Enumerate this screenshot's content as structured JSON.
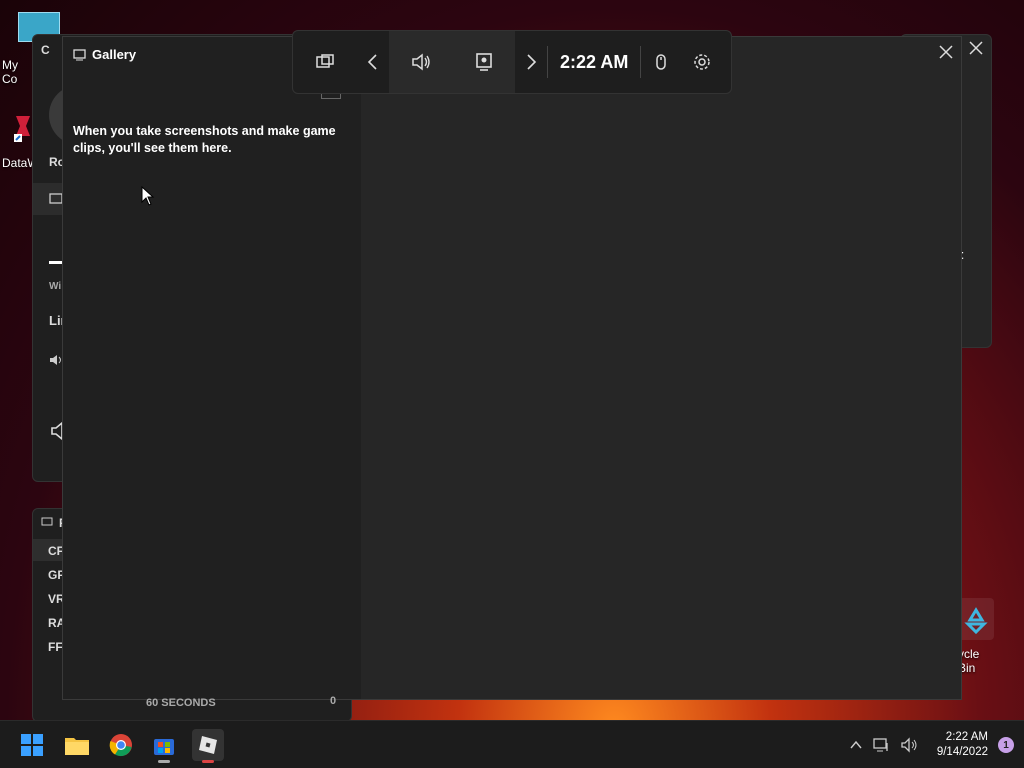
{
  "desktop": {
    "icons": [
      {
        "label": "My Co"
      },
      {
        "label": "DataW"
      },
      {
        "label": "ycle Bin"
      }
    ]
  },
  "background_widgets": {
    "capture_title_fragment": "C",
    "capture_row_labels": [
      "Ro",
      "Wi",
      "Lin"
    ],
    "performance_title_fragment": "P",
    "performance_rows": [
      "CF",
      "GF",
      "VR",
      "RA",
      "FF"
    ],
    "seconds_label": "60 SECONDS",
    "seconds_value": "0",
    "audio_fragment": "t"
  },
  "gallery": {
    "title": "Gallery",
    "empty_message": "When you take screenshots and make game clips, you'll see them here."
  },
  "gamebar": {
    "time": "2:22 AM",
    "buttons": [
      "widget-menu",
      "previous",
      "audio",
      "capture",
      "next",
      "mouse",
      "settings"
    ]
  },
  "taskbar": {
    "apps": [
      "start",
      "file-explorer",
      "chrome",
      "microsoft-store",
      "roblox"
    ],
    "clock_time": "2:22 AM",
    "clock_date": "9/14/2022",
    "notification_count": "1"
  },
  "colors": {
    "panel": "#202020",
    "window": "#262626",
    "accent_start": "#0a84ff"
  }
}
